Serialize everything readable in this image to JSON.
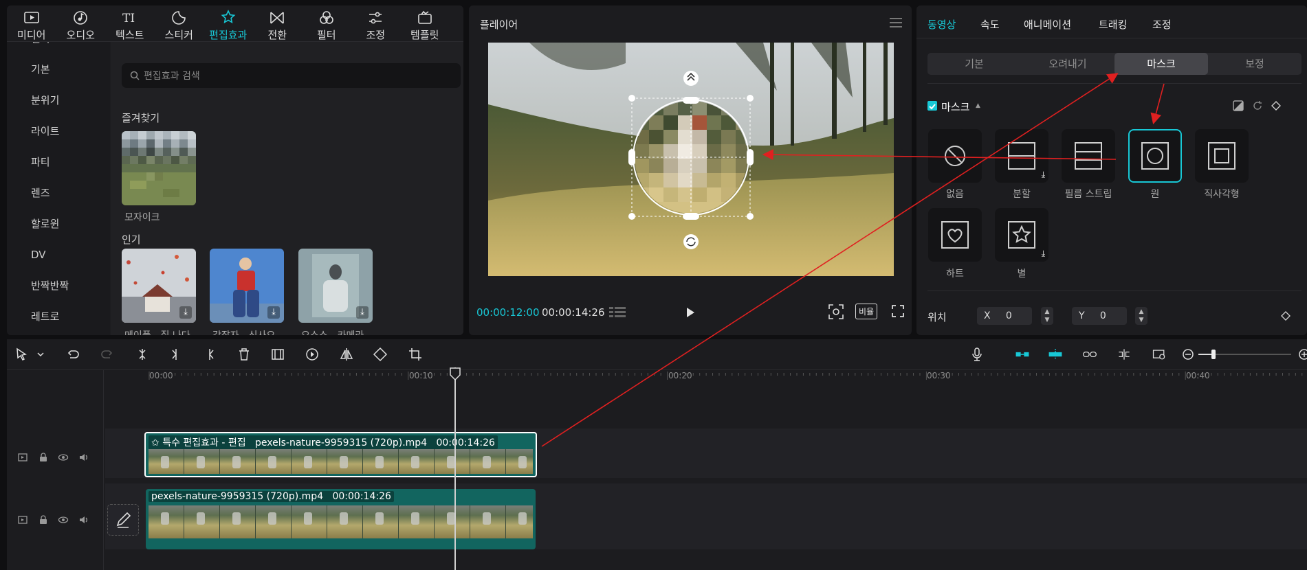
{
  "media_panel": {
    "tabs": [
      {
        "label": "미디어",
        "icon": "media-icon",
        "active": false
      },
      {
        "label": "오디오",
        "icon": "audio-icon",
        "active": false
      },
      {
        "label": "텍스트",
        "icon": "text-icon",
        "active": false
      },
      {
        "label": "스티커",
        "icon": "sticker-icon",
        "active": false
      },
      {
        "label": "편집효과",
        "icon": "effects-icon",
        "active": true
      },
      {
        "label": "전환",
        "icon": "transition-icon",
        "active": false
      },
      {
        "label": "필터",
        "icon": "filter-icon",
        "active": false
      },
      {
        "label": "조정",
        "icon": "adjust-icon",
        "active": false
      },
      {
        "label": "템플릿",
        "icon": "template-icon",
        "active": false
      }
    ],
    "sidebar": [
      "인기",
      "기본",
      "분위기",
      "라이트",
      "파티",
      "렌즈",
      "할로윈",
      "DV",
      "반짝반짝",
      "레트로"
    ],
    "search_placeholder": "편집효과 검색",
    "favorites_title": "즐겨찾기",
    "favorites": [
      {
        "label": "모자이크"
      }
    ],
    "popular_title": "인기",
    "popular": [
      {
        "label": "메이플 - 질 나다"
      },
      {
        "label": "각잡자 - 신사오"
      },
      {
        "label": "오소소 - 카메라"
      }
    ]
  },
  "player": {
    "title": "플레이어",
    "current_time": "00:00:12:00",
    "total_time": "00:00:14:26",
    "ratio_label": "비율"
  },
  "inspector": {
    "tabs": [
      {
        "label": "동영상",
        "active": true
      },
      {
        "label": "속도",
        "active": false
      },
      {
        "label": "애니메이션",
        "active": false
      },
      {
        "label": "트래킹",
        "active": false
      },
      {
        "label": "조정",
        "active": false
      }
    ],
    "subtabs": [
      {
        "label": "기본",
        "active": false
      },
      {
        "label": "오려내기",
        "active": false
      },
      {
        "label": "마스크",
        "active": true
      },
      {
        "label": "보정",
        "active": false
      }
    ],
    "mask_section_label": "마스크",
    "mask_enabled": true,
    "masks": [
      {
        "label": "없음",
        "icon": "none-icon",
        "selected": false,
        "download": false
      },
      {
        "label": "분할",
        "icon": "split-icon",
        "selected": false,
        "download": true
      },
      {
        "label": "필름 스트립",
        "icon": "filmstrip-icon",
        "selected": false,
        "download": false
      },
      {
        "label": "원",
        "icon": "circle-icon",
        "selected": true,
        "download": false
      },
      {
        "label": "직사각형",
        "icon": "rectangle-icon",
        "selected": false,
        "download": false
      },
      {
        "label": "하트",
        "icon": "heart-icon",
        "selected": false,
        "download": false
      },
      {
        "label": "별",
        "icon": "star-icon",
        "selected": false,
        "download": true
      }
    ],
    "position": {
      "label": "위치",
      "x_label": "X",
      "x": "0",
      "y_label": "Y",
      "y": "0"
    }
  },
  "timeline": {
    "ruler_labels": [
      "00:00",
      "00:10",
      "00:20",
      "00:30",
      "00:40"
    ],
    "effect_clip": {
      "label": "특수 편집효과 - 편집",
      "file": "pexels-nature-9959315 (720p).mp4",
      "duration": "00:00:14:26"
    },
    "main_clip": {
      "file": "pexels-nature-9959315 (720p).mp4",
      "duration": "00:00:14:26"
    }
  },
  "colors": {
    "accent": "#18c8d6",
    "annotation": "#e02020"
  }
}
